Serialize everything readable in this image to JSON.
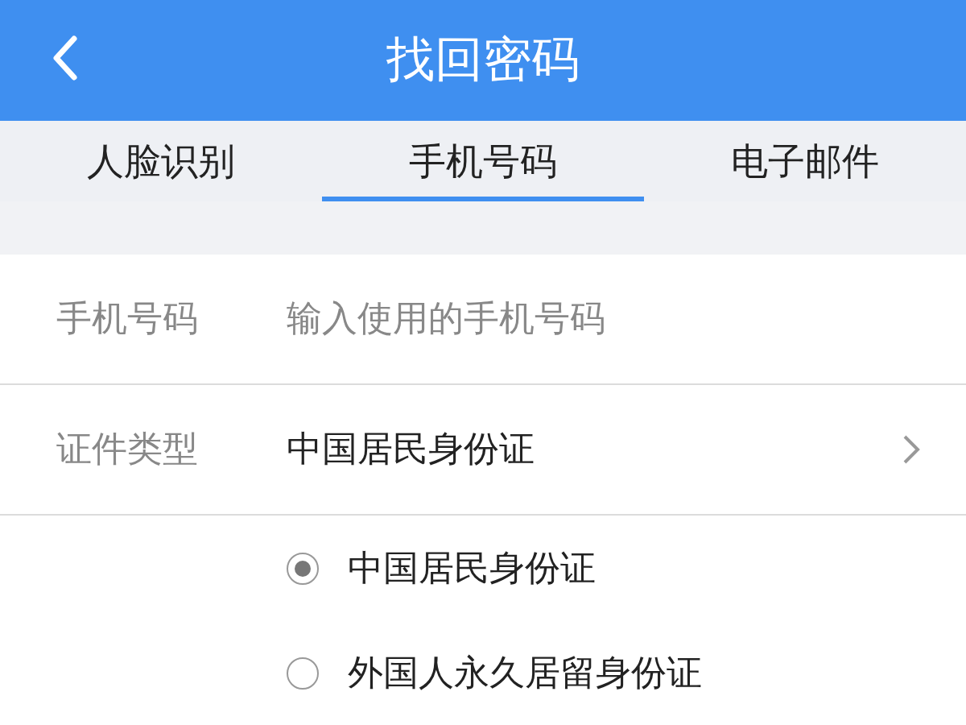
{
  "header": {
    "title": "找回密码"
  },
  "tabs": [
    {
      "label": "人脸识别",
      "selected": false
    },
    {
      "label": "手机号码",
      "selected": true
    },
    {
      "label": "电子邮件",
      "selected": false
    }
  ],
  "phone": {
    "label": "手机号码",
    "placeholder": "输入使用的手机号码"
  },
  "id_type": {
    "label": "证件类型",
    "value": "中国居民身份证"
  },
  "options": [
    {
      "label": "中国居民身份证",
      "selected": true
    },
    {
      "label": "外国人永久居留身份证",
      "selected": false
    }
  ]
}
